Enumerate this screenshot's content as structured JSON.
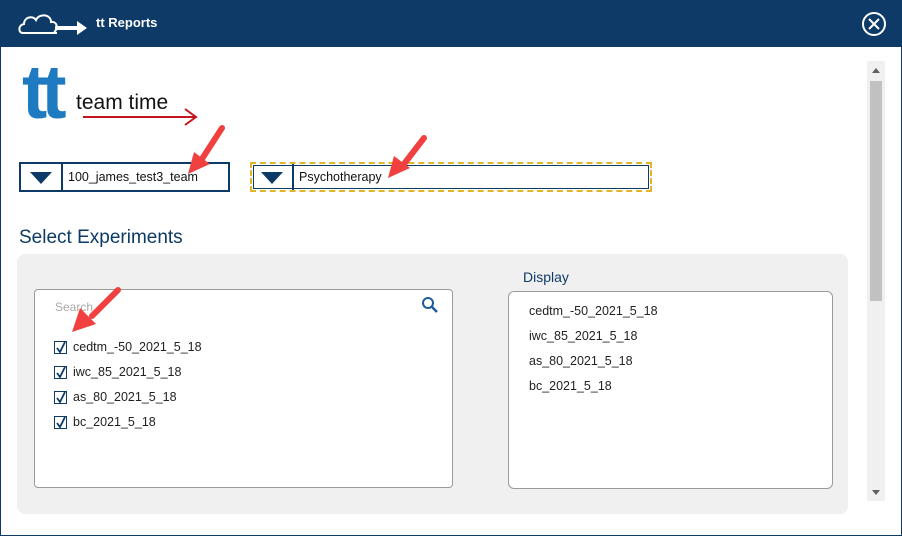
{
  "window": {
    "title": "tt Reports"
  },
  "logo": {
    "mark": "tt",
    "text": "team time"
  },
  "dropdowns": {
    "team": {
      "value": "100_james_test3_team"
    },
    "study": {
      "value": "Psychotherapy"
    }
  },
  "section": {
    "title": "Select Experiments"
  },
  "search": {
    "placeholder": "Search"
  },
  "experiments": [
    {
      "label": "cedtm_-50_2021_5_18",
      "checked": true
    },
    {
      "label": "iwc_85_2021_5_18",
      "checked": true
    },
    {
      "label": "as_80_2021_5_18",
      "checked": true
    },
    {
      "label": "bc_2021_5_18",
      "checked": true
    }
  ],
  "display": {
    "title": "Display",
    "items": [
      "cedtm_-50_2021_5_18",
      "iwc_85_2021_5_18",
      "as_80_2021_5_18",
      "bc_2021_5_18"
    ]
  },
  "colors": {
    "brand": "#0d3a66",
    "logo": "#1e7bc2",
    "annotation": "#f04040",
    "focus": "#e2b528"
  }
}
